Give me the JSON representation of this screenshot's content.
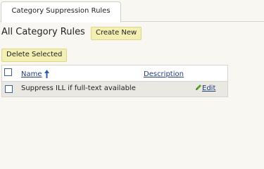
{
  "tabs": [
    {
      "label": "Category Suppression Rules"
    }
  ],
  "page": {
    "title": "All Category Rules",
    "create_button": "Create New",
    "delete_button": "Delete Selected"
  },
  "table": {
    "columns": {
      "name": "Name",
      "description": "Description"
    },
    "rows": [
      {
        "name": "Suppress ILL if full-text available",
        "description": "",
        "action": "Edit"
      }
    ]
  },
  "colors": {
    "background": "#f8f7f2",
    "button_fill": "#f4f0b4",
    "link": "#1f3d7a",
    "row_fill": "#e9e8e3",
    "edit_icon": "#5aa02c"
  },
  "icons": {
    "sort": "sort-ascending-arrow-icon",
    "edit": "pencil-icon"
  }
}
